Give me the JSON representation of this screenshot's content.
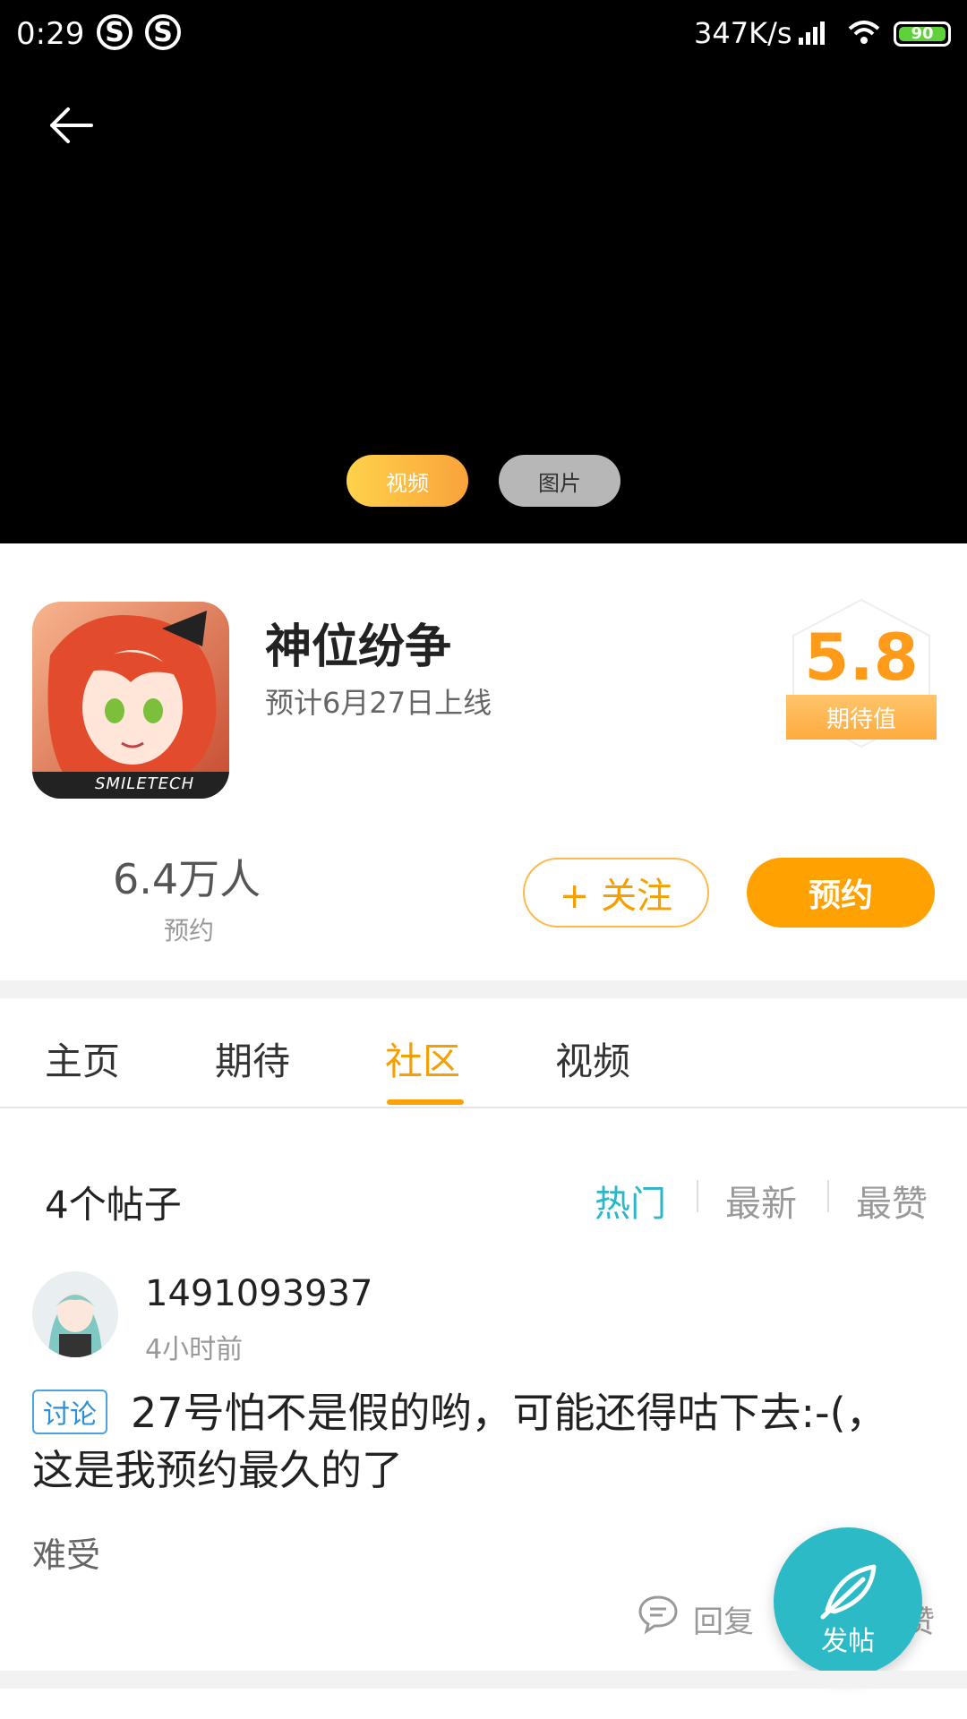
{
  "status_bar": {
    "time": "0:29",
    "net_speed": "347K/s",
    "battery": "90",
    "app_badges": [
      "S",
      "S"
    ]
  },
  "media_tabs": {
    "video": "视频",
    "image": "图片"
  },
  "game": {
    "title": "神位纷争",
    "release": "预计6月27日上线",
    "icon_caption": "SMILETECH",
    "expectation_score": "5.8",
    "expectation_label": "期待值",
    "reservations_count": "6.4万人",
    "reservations_label": "预约",
    "follow_label": "+ 关注",
    "reserve_label": "预约"
  },
  "tabs": [
    "主页",
    "期待",
    "社区",
    "视频"
  ],
  "active_tab": "社区",
  "posts_header": {
    "count": "4个帖子",
    "sorts": [
      "热门",
      "最新",
      "最赞"
    ],
    "active_sort": "热门"
  },
  "post": {
    "username": "1491093937",
    "time": "4小时前",
    "tag": "讨论",
    "title": "27号怕不是假的哟，可能还得咕下去:-(，这是我预约最久的了",
    "excerpt": "难受",
    "reply_label": "回复",
    "like_partial": "赞"
  },
  "fab_label": "发帖",
  "colors": {
    "accent_orange": "#ffa100",
    "accent_teal": "#2bbac6",
    "tag_blue": "#2d8fd6"
  }
}
